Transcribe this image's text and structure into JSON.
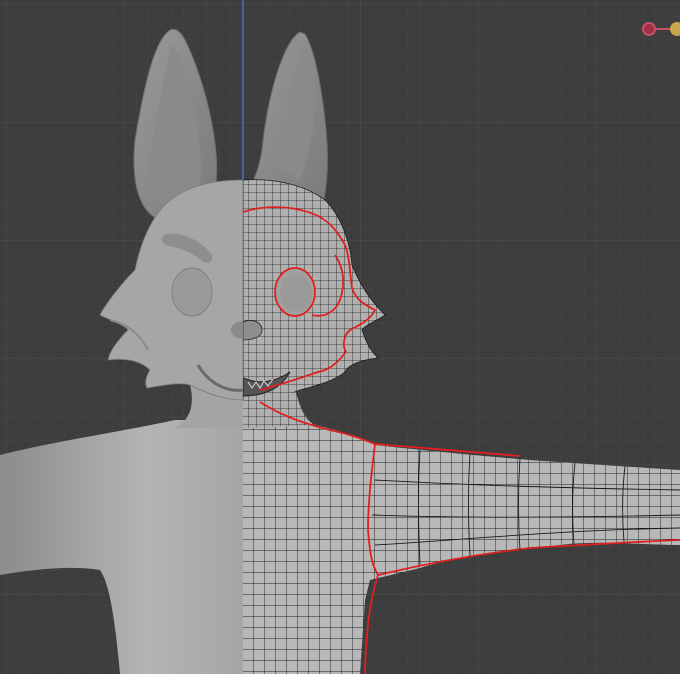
{
  "viewport": {
    "background": "#3d3d3d",
    "grid_color": "#474747"
  },
  "model": {
    "solid_color": "#a9a9a9",
    "wire_color": "#1c1c1c",
    "seam_color": "#e02020"
  },
  "axes": {
    "vertical_axis_color": "#3f7fd6"
  },
  "gizmo": {
    "x_axis_color": "#c8506a",
    "y_axis_color": "#c9a64a",
    "icon": "navigation-gizmo-icon"
  }
}
